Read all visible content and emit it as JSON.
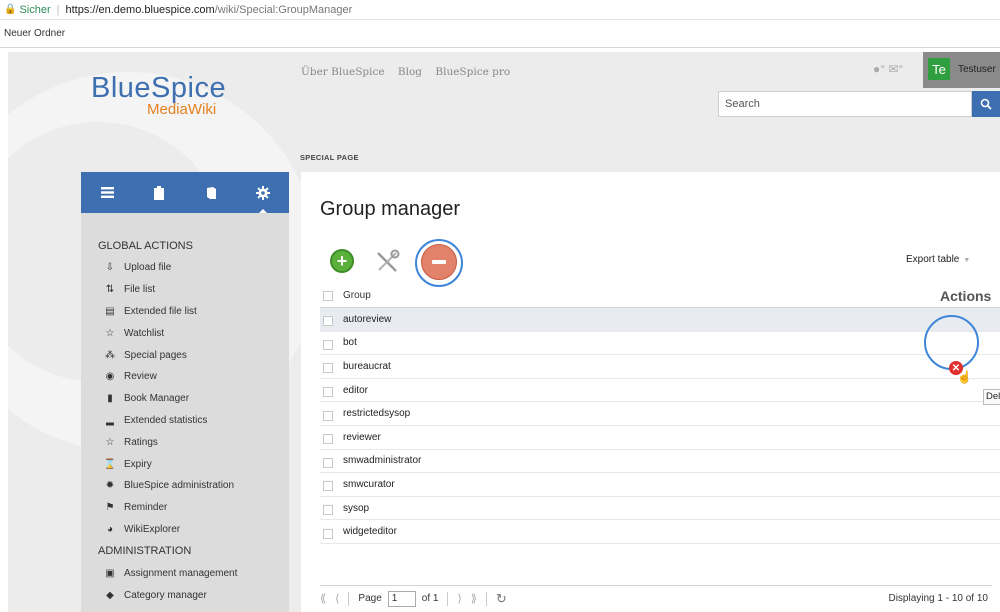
{
  "browser": {
    "secure_label": "Sicher",
    "url_host": "https://en.demo.bluespice.com",
    "url_path": "/wiki/Special:GroupManager",
    "bookmark": "Neuer Ordner"
  },
  "logo": {
    "main_blue": "BlueSpice",
    "sub": "MediaWiki"
  },
  "topnav": [
    "Über BlueSpice",
    "Blog",
    "BlueSpice pro"
  ],
  "user": {
    "avatar_text": "Te",
    "name": "Testuser"
  },
  "search": {
    "placeholder": "Search"
  },
  "special_label": "SPECIAL PAGE",
  "page_title": "Group manager",
  "sidebar": {
    "global_heading": "GLOBAL ACTIONS",
    "global_items": [
      {
        "label": "Upload file",
        "icon": "upload-icon"
      },
      {
        "label": "File list",
        "icon": "sort-icon"
      },
      {
        "label": "Extended file list",
        "icon": "list-icon"
      },
      {
        "label": "Watchlist",
        "icon": "star-icon"
      },
      {
        "label": "Special pages",
        "icon": "special-icon"
      },
      {
        "label": "Review",
        "icon": "eye-icon"
      },
      {
        "label": "Book Manager",
        "icon": "book-icon"
      },
      {
        "label": "Extended statistics",
        "icon": "chart-icon"
      },
      {
        "label": "Ratings",
        "icon": "star-icon"
      },
      {
        "label": "Expiry",
        "icon": "hourglass-icon"
      },
      {
        "label": "BlueSpice administration",
        "icon": "gear-icon"
      },
      {
        "label": "Reminder",
        "icon": "flag-icon"
      },
      {
        "label": "WikiExplorer",
        "icon": "globe-icon"
      }
    ],
    "admin_heading": "ADMINISTRATION",
    "admin_items": [
      {
        "label": "Assignment management",
        "icon": "assignment-icon"
      },
      {
        "label": "Category manager",
        "icon": "tag-icon"
      }
    ]
  },
  "toolbar": {
    "export_label": "Export table"
  },
  "grid": {
    "col_group": "Group",
    "col_actions": "Actions",
    "rows": [
      "autoreview",
      "bot",
      "bureaucrat",
      "editor",
      "restrictedsysop",
      "reviewer",
      "smwadministrator",
      "smwcurator",
      "sysop",
      "widgeteditor"
    ]
  },
  "tooltip": "Delete",
  "pager": {
    "page_label": "Page",
    "page_value": "1",
    "of_label": "of 1",
    "display_text": "Displaying 1 - 10 of 10"
  },
  "colors": {
    "accent": "#3e6fb0",
    "logo_orange": "#e5821f",
    "add_green": "#5ab03a",
    "remove_red": "#e2826a",
    "highlight_ring": "#3f86d9"
  }
}
